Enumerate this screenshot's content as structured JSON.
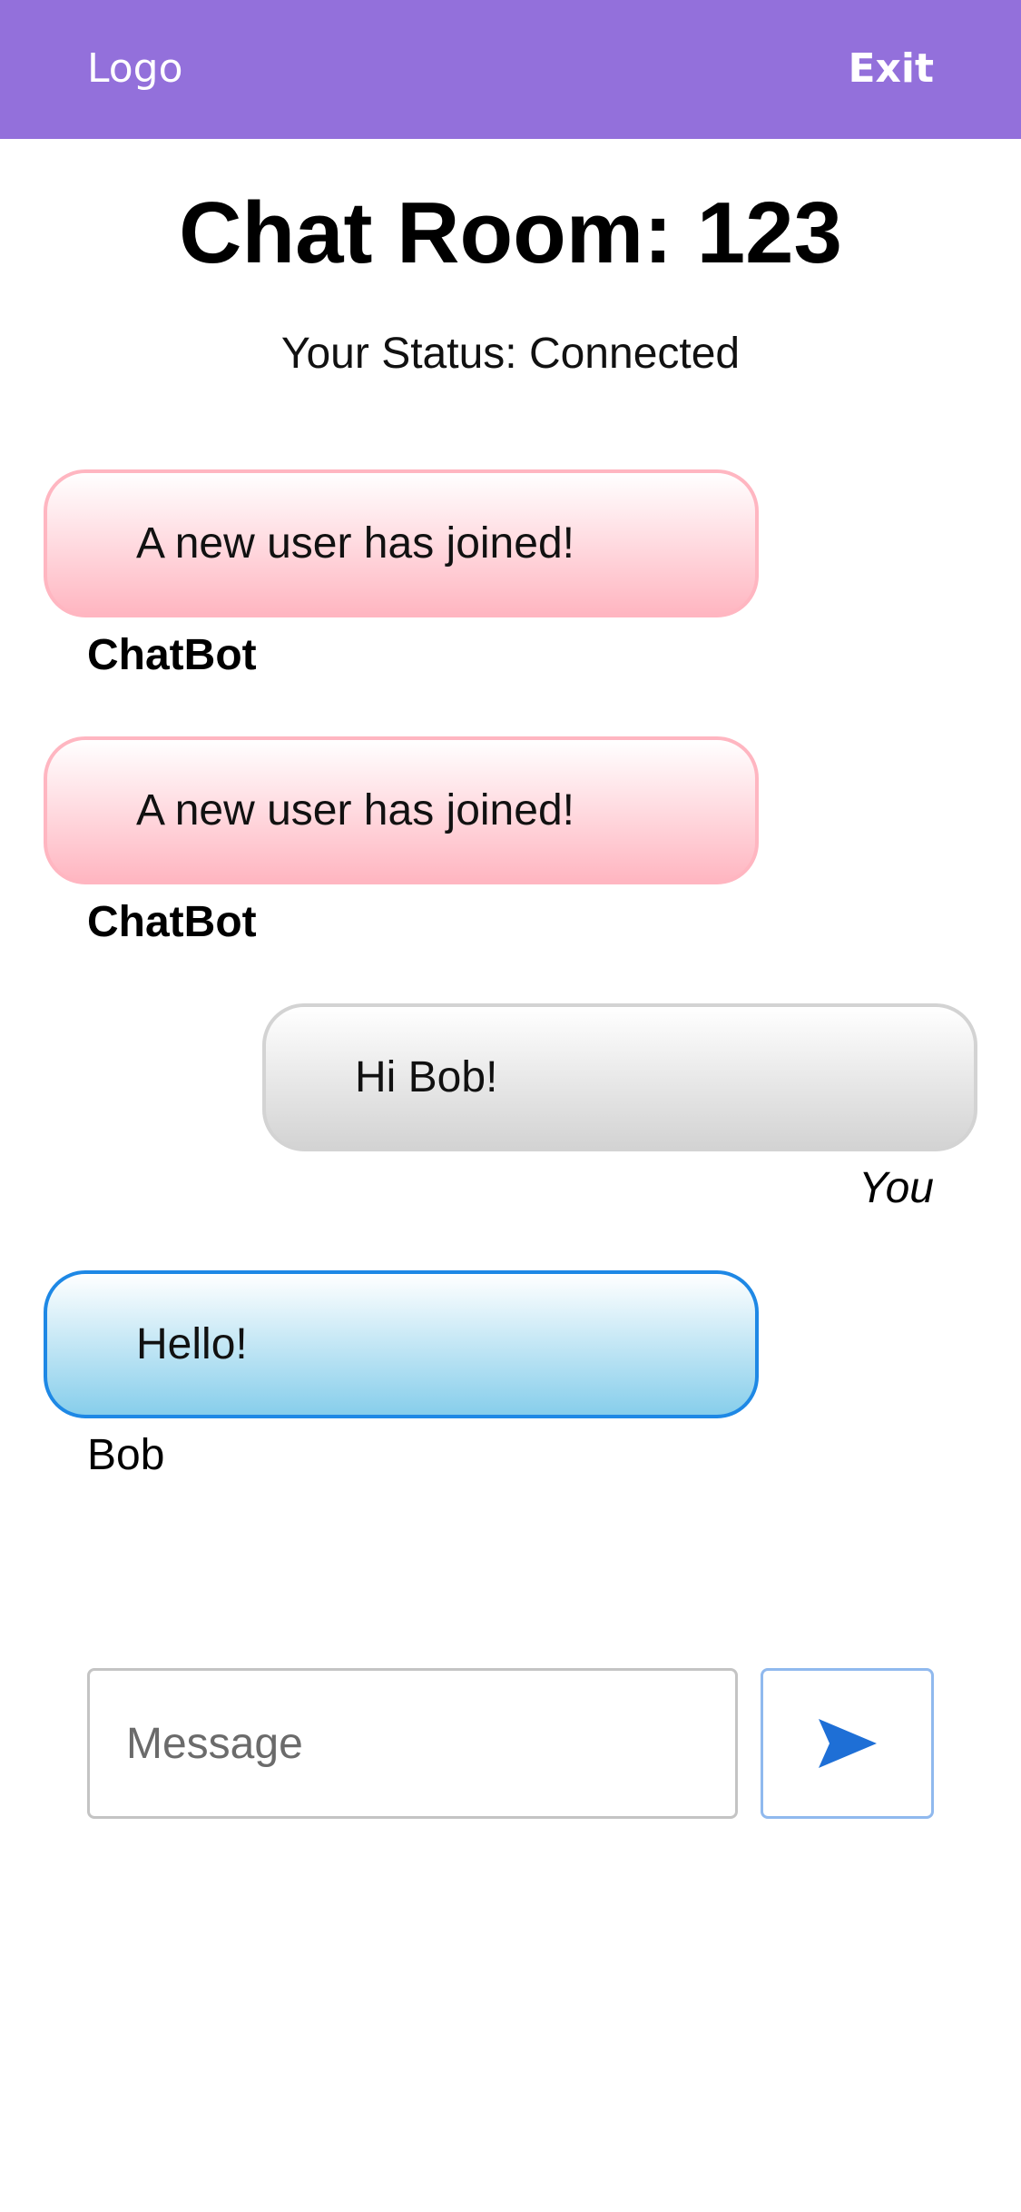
{
  "header": {
    "logo": "Logo",
    "exit_label": "Exit",
    "background_color": "#9370DB"
  },
  "room": {
    "title": "Chat Room: 123",
    "status": "Your Status: Connected"
  },
  "messages": [
    {
      "text": "A new user has joined!",
      "sender": "ChatBot",
      "kind": "bot",
      "sender_style": "bold",
      "align": "left"
    },
    {
      "text": "A new user has joined!",
      "sender": "ChatBot",
      "kind": "bot",
      "sender_style": "bold",
      "align": "left"
    },
    {
      "text": "Hi Bob!",
      "sender": "You",
      "kind": "self",
      "sender_style": "italic",
      "align": "right"
    },
    {
      "text": "Hello!",
      "sender": "Bob",
      "kind": "other",
      "sender_style": "normal",
      "align": "left"
    }
  ],
  "composer": {
    "placeholder": "Message",
    "value": "",
    "send_icon": "send-icon",
    "accent_color": "#1e6fd6"
  },
  "colors": {
    "bot_bubble": "#ffb6c1",
    "self_bubble": "#d3d3d3",
    "other_bubble": "#87ceeb",
    "other_border": "#1e88e5"
  }
}
